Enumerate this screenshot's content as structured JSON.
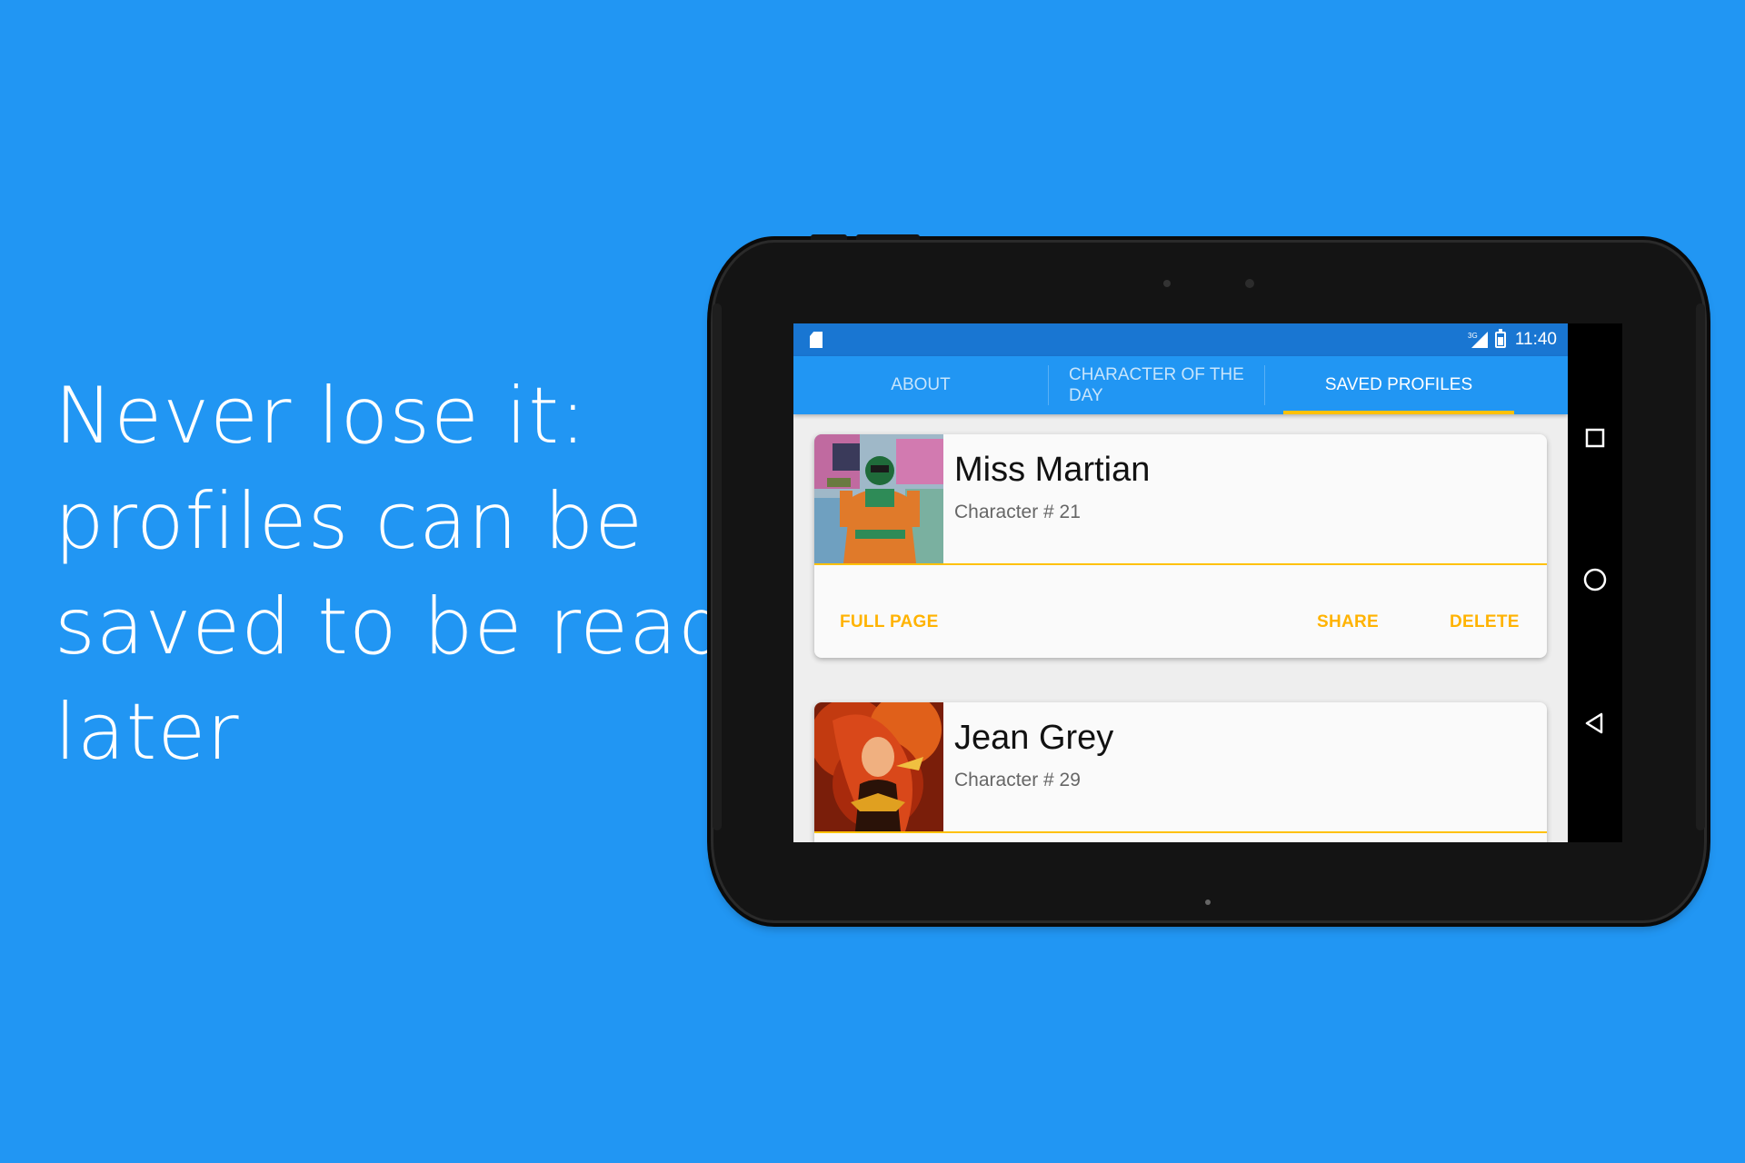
{
  "promo": {
    "line1": "Never lose it:",
    "line2": "profiles can be",
    "line3": "saved to be read",
    "line4": "later"
  },
  "statusbar": {
    "network": "3G",
    "time": "11:40"
  },
  "tabs": [
    {
      "label": "ABOUT",
      "active": false
    },
    {
      "label": "CHARACTER OF THE DAY",
      "active": false
    },
    {
      "label": "SAVED PROFILES",
      "active": true
    }
  ],
  "profiles": [
    {
      "name": "Miss Martian",
      "subtitle": "Character # 21",
      "actions": {
        "full_page": "FULL PAGE",
        "share": "SHARE",
        "delete": "DELETE"
      }
    },
    {
      "name": "Jean Grey",
      "subtitle": "Character # 29"
    }
  ],
  "colors": {
    "background": "#2196F3",
    "statusbar": "#1976D2",
    "tabbar": "#2196F3",
    "accent": "#FFC107",
    "action_text": "#FFB300"
  },
  "icons": {
    "nav": [
      "recents-icon",
      "home-icon",
      "back-icon"
    ],
    "status": [
      "sd-card-icon",
      "signal-icon",
      "battery-icon"
    ]
  }
}
